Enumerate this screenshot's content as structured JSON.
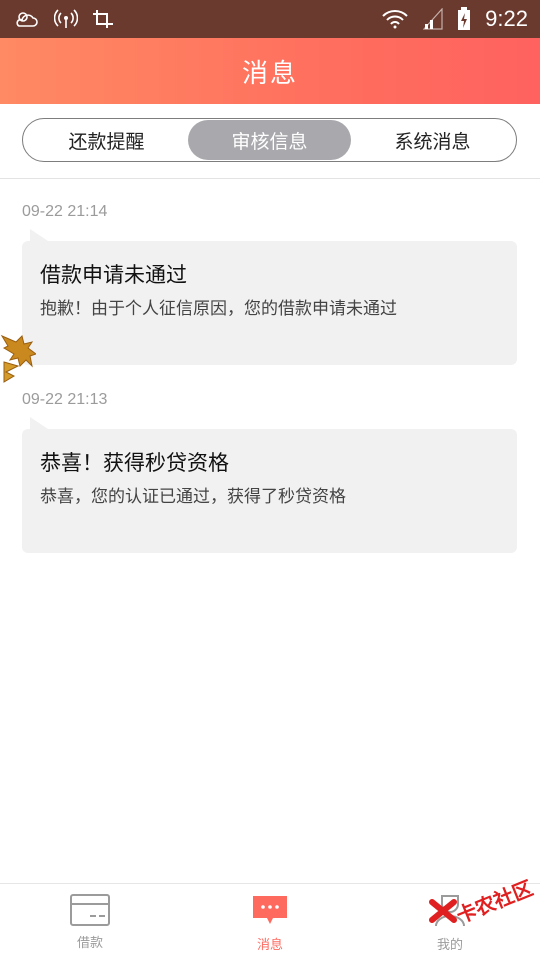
{
  "status_bar": {
    "time": "9:22",
    "left_icons": [
      "weather-icon",
      "signal-broadcast-icon",
      "crop-icon"
    ],
    "right_icons": [
      "wifi-icon",
      "cell-signal-icon",
      "battery-charging-icon"
    ]
  },
  "header": {
    "title": "消息"
  },
  "tabs": [
    {
      "label": "还款提醒",
      "active": false
    },
    {
      "label": "审核信息",
      "active": true
    },
    {
      "label": "系统消息",
      "active": false
    }
  ],
  "messages": [
    {
      "time": "09-22  21:14",
      "title": "借款申请未通过",
      "body": "抱歉！由于个人征信原因，您的借款申请未通过"
    },
    {
      "time": "09-22  21:13",
      "title": "恭喜！获得秒贷资格",
      "body": "恭喜，您的认证已通过，获得了秒贷资格"
    }
  ],
  "bottom_nav": [
    {
      "label": "借款",
      "icon": "card-icon",
      "active": false
    },
    {
      "label": "消息",
      "icon": "chat-bubble-icon",
      "active": true
    },
    {
      "label": "我的",
      "icon": "user-icon",
      "active": false
    }
  ],
  "watermark": {
    "text": "卡农社区"
  },
  "colors": {
    "accent": "#ff6a5f",
    "header_gradient_start": "#ff8a63",
    "header_gradient_end": "#ff625f",
    "tab_active_bg": "#a9a9ad",
    "bubble_bg": "#f1f1f1",
    "status_bar_bg": "#6b3a2e"
  }
}
